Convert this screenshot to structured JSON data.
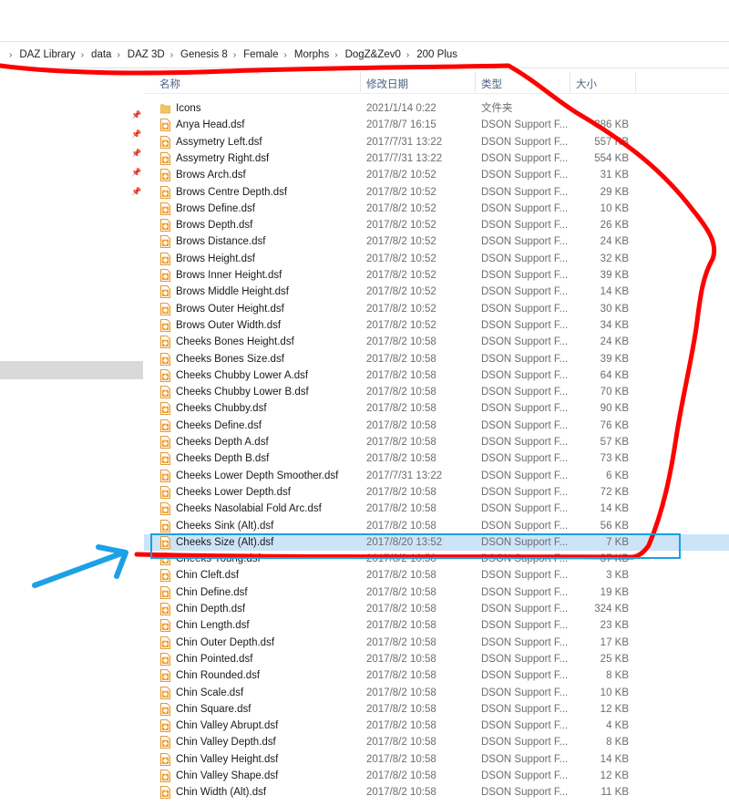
{
  "breadcrumb": [
    "DAZ Library",
    "data",
    "DAZ 3D",
    "Genesis 8",
    "Female",
    "Morphs",
    "DogZ&Zev0",
    "200 Plus"
  ],
  "columns": {
    "name": "名称",
    "date": "修改日期",
    "type": "类型",
    "size": "大小"
  },
  "files": [
    {
      "name": "Icons",
      "date": "2021/1/14 0:22",
      "type": "文件夹",
      "size": "",
      "kind": "folder"
    },
    {
      "name": "Anya Head.dsf",
      "date": "2017/8/7 16:15",
      "type": "DSON Support F...",
      "size": "386 KB",
      "kind": "file"
    },
    {
      "name": "Assymetry Left.dsf",
      "date": "2017/7/31 13:22",
      "type": "DSON Support F...",
      "size": "557 KB",
      "kind": "file"
    },
    {
      "name": "Assymetry Right.dsf",
      "date": "2017/7/31 13:22",
      "type": "DSON Support F...",
      "size": "554 KB",
      "kind": "file"
    },
    {
      "name": "Brows Arch.dsf",
      "date": "2017/8/2 10:52",
      "type": "DSON Support F...",
      "size": "31 KB",
      "kind": "file"
    },
    {
      "name": "Brows Centre Depth.dsf",
      "date": "2017/8/2 10:52",
      "type": "DSON Support F...",
      "size": "29 KB",
      "kind": "file"
    },
    {
      "name": "Brows Define.dsf",
      "date": "2017/8/2 10:52",
      "type": "DSON Support F...",
      "size": "10 KB",
      "kind": "file"
    },
    {
      "name": "Brows Depth.dsf",
      "date": "2017/8/2 10:52",
      "type": "DSON Support F...",
      "size": "26 KB",
      "kind": "file"
    },
    {
      "name": "Brows Distance.dsf",
      "date": "2017/8/2 10:52",
      "type": "DSON Support F...",
      "size": "24 KB",
      "kind": "file"
    },
    {
      "name": "Brows Height.dsf",
      "date": "2017/8/2 10:52",
      "type": "DSON Support F...",
      "size": "32 KB",
      "kind": "file"
    },
    {
      "name": "Brows Inner Height.dsf",
      "date": "2017/8/2 10:52",
      "type": "DSON Support F...",
      "size": "39 KB",
      "kind": "file"
    },
    {
      "name": "Brows Middle Height.dsf",
      "date": "2017/8/2 10:52",
      "type": "DSON Support F...",
      "size": "14 KB",
      "kind": "file"
    },
    {
      "name": "Brows Outer Height.dsf",
      "date": "2017/8/2 10:52",
      "type": "DSON Support F...",
      "size": "30 KB",
      "kind": "file"
    },
    {
      "name": "Brows Outer Width.dsf",
      "date": "2017/8/2 10:52",
      "type": "DSON Support F...",
      "size": "34 KB",
      "kind": "file"
    },
    {
      "name": "Cheeks Bones Height.dsf",
      "date": "2017/8/2 10:58",
      "type": "DSON Support F...",
      "size": "24 KB",
      "kind": "file"
    },
    {
      "name": "Cheeks Bones Size.dsf",
      "date": "2017/8/2 10:58",
      "type": "DSON Support F...",
      "size": "39 KB",
      "kind": "file"
    },
    {
      "name": "Cheeks Chubby Lower A.dsf",
      "date": "2017/8/2 10:58",
      "type": "DSON Support F...",
      "size": "64 KB",
      "kind": "file"
    },
    {
      "name": "Cheeks Chubby Lower B.dsf",
      "date": "2017/8/2 10:58",
      "type": "DSON Support F...",
      "size": "70 KB",
      "kind": "file"
    },
    {
      "name": "Cheeks Chubby.dsf",
      "date": "2017/8/2 10:58",
      "type": "DSON Support F...",
      "size": "90 KB",
      "kind": "file"
    },
    {
      "name": "Cheeks Define.dsf",
      "date": "2017/8/2 10:58",
      "type": "DSON Support F...",
      "size": "76 KB",
      "kind": "file"
    },
    {
      "name": "Cheeks Depth A.dsf",
      "date": "2017/8/2 10:58",
      "type": "DSON Support F...",
      "size": "57 KB",
      "kind": "file"
    },
    {
      "name": "Cheeks Depth B.dsf",
      "date": "2017/8/2 10:58",
      "type": "DSON Support F...",
      "size": "73 KB",
      "kind": "file"
    },
    {
      "name": "Cheeks Lower Depth Smoother.dsf",
      "date": "2017/7/31 13:22",
      "type": "DSON Support F...",
      "size": "6 KB",
      "kind": "file"
    },
    {
      "name": "Cheeks Lower Depth.dsf",
      "date": "2017/8/2 10:58",
      "type": "DSON Support F...",
      "size": "72 KB",
      "kind": "file"
    },
    {
      "name": "Cheeks Nasolabial Fold Arc.dsf",
      "date": "2017/8/2 10:58",
      "type": "DSON Support F...",
      "size": "14 KB",
      "kind": "file"
    },
    {
      "name": "Cheeks Sink (Alt).dsf",
      "date": "2017/8/2 10:58",
      "type": "DSON Support F...",
      "size": "56 KB",
      "kind": "file"
    },
    {
      "name": "Cheeks Size (Alt).dsf",
      "date": "2017/8/20 13:52",
      "type": "DSON Support F...",
      "size": "7 KB",
      "kind": "file",
      "selected": true
    },
    {
      "name": "Cheeks Young.dsf",
      "date": "2017/8/2 10:58",
      "type": "DSON Support F...",
      "size": "37 KB",
      "kind": "file"
    },
    {
      "name": "Chin Cleft.dsf",
      "date": "2017/8/2 10:58",
      "type": "DSON Support F...",
      "size": "3 KB",
      "kind": "file"
    },
    {
      "name": "Chin Define.dsf",
      "date": "2017/8/2 10:58",
      "type": "DSON Support F...",
      "size": "19 KB",
      "kind": "file"
    },
    {
      "name": "Chin Depth.dsf",
      "date": "2017/8/2 10:58",
      "type": "DSON Support F...",
      "size": "324 KB",
      "kind": "file"
    },
    {
      "name": "Chin Length.dsf",
      "date": "2017/8/2 10:58",
      "type": "DSON Support F...",
      "size": "23 KB",
      "kind": "file"
    },
    {
      "name": "Chin Outer Depth.dsf",
      "date": "2017/8/2 10:58",
      "type": "DSON Support F...",
      "size": "17 KB",
      "kind": "file"
    },
    {
      "name": "Chin Pointed.dsf",
      "date": "2017/8/2 10:58",
      "type": "DSON Support F...",
      "size": "25 KB",
      "kind": "file"
    },
    {
      "name": "Chin Rounded.dsf",
      "date": "2017/8/2 10:58",
      "type": "DSON Support F...",
      "size": "8 KB",
      "kind": "file"
    },
    {
      "name": "Chin Scale.dsf",
      "date": "2017/8/2 10:58",
      "type": "DSON Support F...",
      "size": "10 KB",
      "kind": "file"
    },
    {
      "name": "Chin Square.dsf",
      "date": "2017/8/2 10:58",
      "type": "DSON Support F...",
      "size": "12 KB",
      "kind": "file"
    },
    {
      "name": "Chin Valley Abrupt.dsf",
      "date": "2017/8/2 10:58",
      "type": "DSON Support F...",
      "size": "4 KB",
      "kind": "file"
    },
    {
      "name": "Chin Valley Depth.dsf",
      "date": "2017/8/2 10:58",
      "type": "DSON Support F...",
      "size": "8 KB",
      "kind": "file"
    },
    {
      "name": "Chin Valley Height.dsf",
      "date": "2017/8/2 10:58",
      "type": "DSON Support F...",
      "size": "14 KB",
      "kind": "file"
    },
    {
      "name": "Chin Valley Shape.dsf",
      "date": "2017/8/2 10:58",
      "type": "DSON Support F...",
      "size": "12 KB",
      "kind": "file"
    },
    {
      "name": "Chin Width (Alt).dsf",
      "date": "2017/8/2 10:58",
      "type": "DSON Support F...",
      "size": "11 KB",
      "kind": "file"
    }
  ],
  "colors": {
    "selection": "#cce4f7",
    "selection_box": "#1aa0e0",
    "annotation_red": "#ff0000",
    "annotation_arrow": "#1da1e6",
    "header_text": "#4d6082"
  },
  "icons": {
    "folder": "folder-icon",
    "file": "dsf-file-icon",
    "pin": "pin-icon",
    "separator": "chevron-right-icon"
  }
}
